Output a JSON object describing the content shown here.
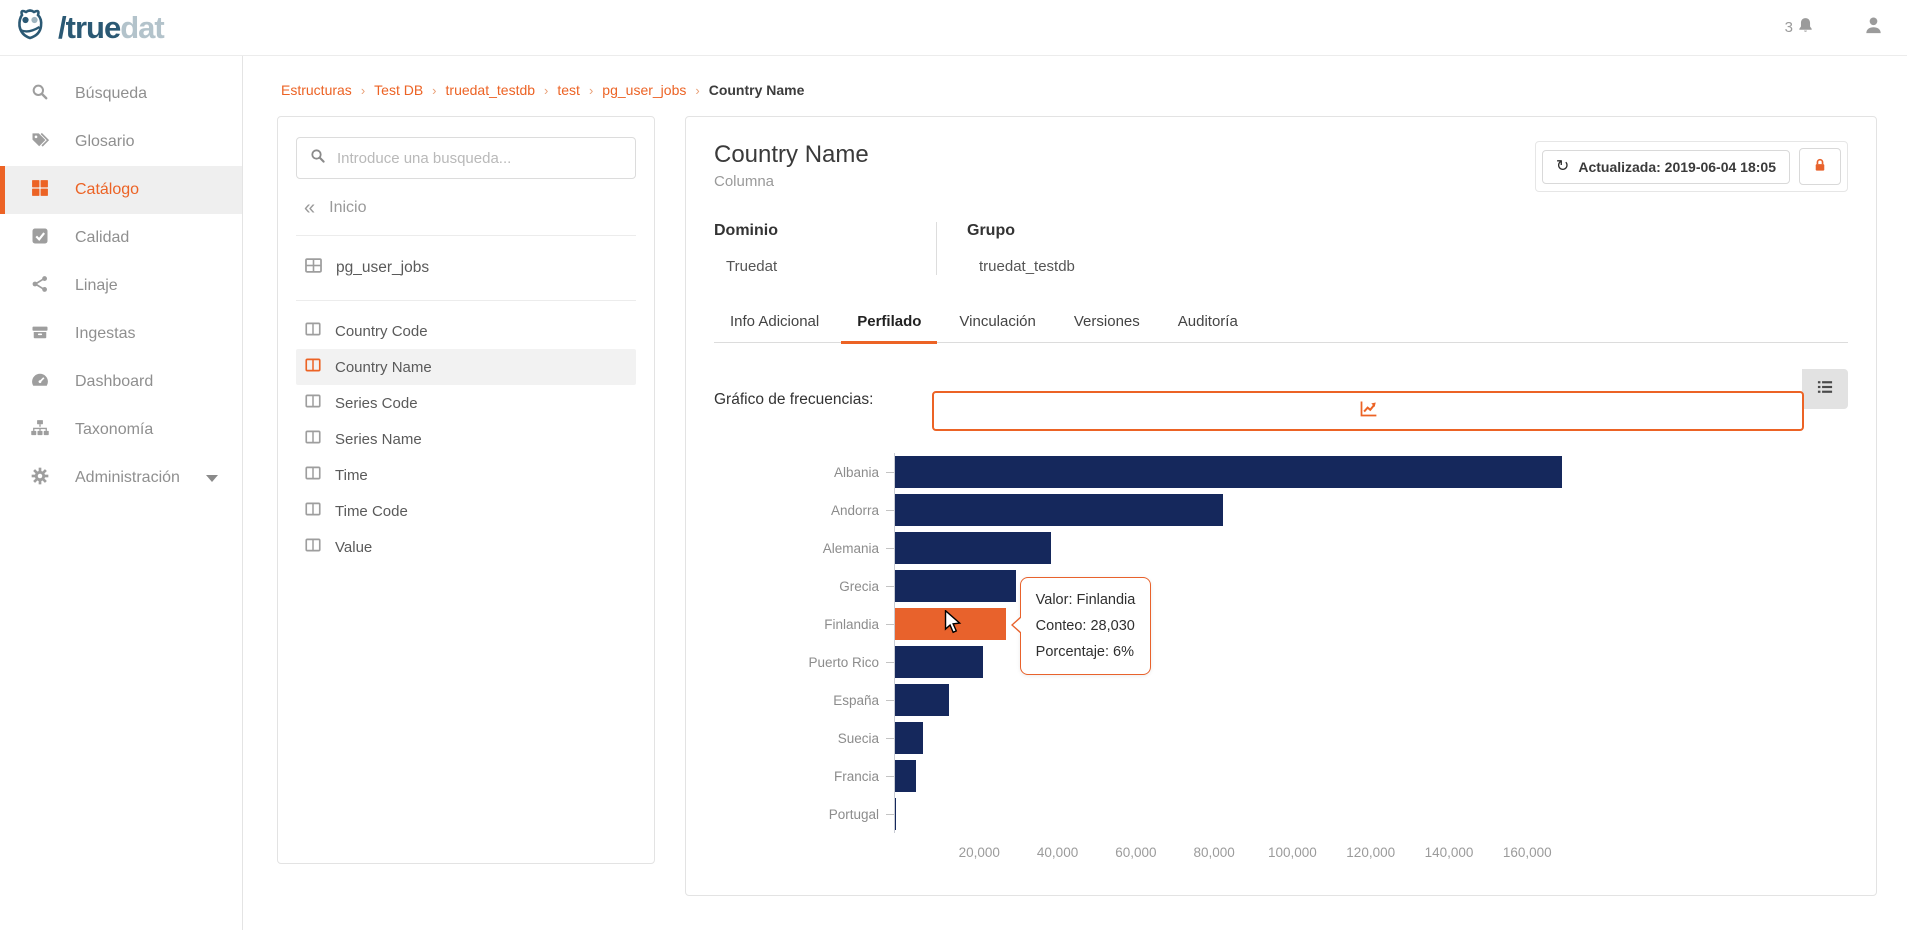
{
  "topbar": {
    "logo_slash": "/",
    "logo_text_dark": "true",
    "logo_text_light": "dat",
    "notifications_count": "3"
  },
  "sidebar": {
    "items": [
      {
        "label": "Búsqueda",
        "icon": "search-icon",
        "active": false
      },
      {
        "label": "Glosario",
        "icon": "tags-icon",
        "active": false
      },
      {
        "label": "Catálogo",
        "icon": "grid-icon",
        "active": true
      },
      {
        "label": "Calidad",
        "icon": "check-square-icon",
        "active": false
      },
      {
        "label": "Linaje",
        "icon": "share-icon",
        "active": false
      },
      {
        "label": "Ingestas",
        "icon": "archive-icon",
        "active": false
      },
      {
        "label": "Dashboard",
        "icon": "gauge-icon",
        "active": false
      },
      {
        "label": "Taxonomía",
        "icon": "sitemap-icon",
        "active": false
      },
      {
        "label": "Administración",
        "icon": "gear-icon",
        "active": false,
        "has_caret": true
      }
    ]
  },
  "breadcrumb": {
    "items": [
      "Estructuras",
      "Test DB",
      "truedat_testdb",
      "test",
      "pg_user_jobs"
    ],
    "current": "Country Name"
  },
  "explorer": {
    "search_placeholder": "Introduce una busqueda...",
    "back_label": "Inicio",
    "table_name": "pg_user_jobs",
    "columns": [
      {
        "name": "Country Code",
        "selected": false
      },
      {
        "name": "Country Name",
        "selected": true
      },
      {
        "name": "Series Code",
        "selected": false
      },
      {
        "name": "Series Name",
        "selected": false
      },
      {
        "name": "Time",
        "selected": false
      },
      {
        "name": "Time Code",
        "selected": false
      },
      {
        "name": "Value",
        "selected": false
      }
    ]
  },
  "detail": {
    "title": "Country Name",
    "subtitle": "Columna",
    "updated_label": "Actualizada: 2019-06-04 18:05",
    "fields": [
      {
        "label": "Dominio",
        "value": "Truedat"
      },
      {
        "label": "Grupo",
        "value": "truedat_testdb"
      }
    ],
    "tabs": [
      {
        "label": "Info Adicional",
        "active": false
      },
      {
        "label": "Perfilado",
        "active": true
      },
      {
        "label": "Vinculación",
        "active": false
      },
      {
        "label": "Versiones",
        "active": false
      },
      {
        "label": "Auditoría",
        "active": false
      }
    ],
    "section_label": "Gráfico de frecuencias:"
  },
  "chart_data": {
    "type": "bar",
    "orientation": "horizontal",
    "title": "Gráfico de frecuencias:",
    "categories": [
      "Albania",
      "Andorra",
      "Alemania",
      "Grecia",
      "Finlandia",
      "Puerto Rico",
      "España",
      "Suecia",
      "Francia",
      "Portugal"
    ],
    "values": [
      169000,
      83000,
      39500,
      30600,
      28030,
      22300,
      13800,
      7000,
      5200,
      300
    ],
    "x_ticks": [
      20000,
      40000,
      60000,
      80000,
      100000,
      120000,
      140000,
      160000
    ],
    "xlim": [
      0,
      175000
    ],
    "grid": false,
    "legend": false,
    "bar_color": "#15285c",
    "highlight_color": "#e8622c",
    "highlight_index": 4,
    "tooltip": {
      "lines": [
        "Valor: Finlandia",
        "Conteo: 28,030",
        "Porcentaje: 6%"
      ]
    }
  },
  "colors": {
    "accent": "#ec6325",
    "bar_navy": "#15285c",
    "bar_orange": "#e8622c",
    "logo_dark": "#2b5974",
    "logo_light": "#b3c3cb"
  }
}
